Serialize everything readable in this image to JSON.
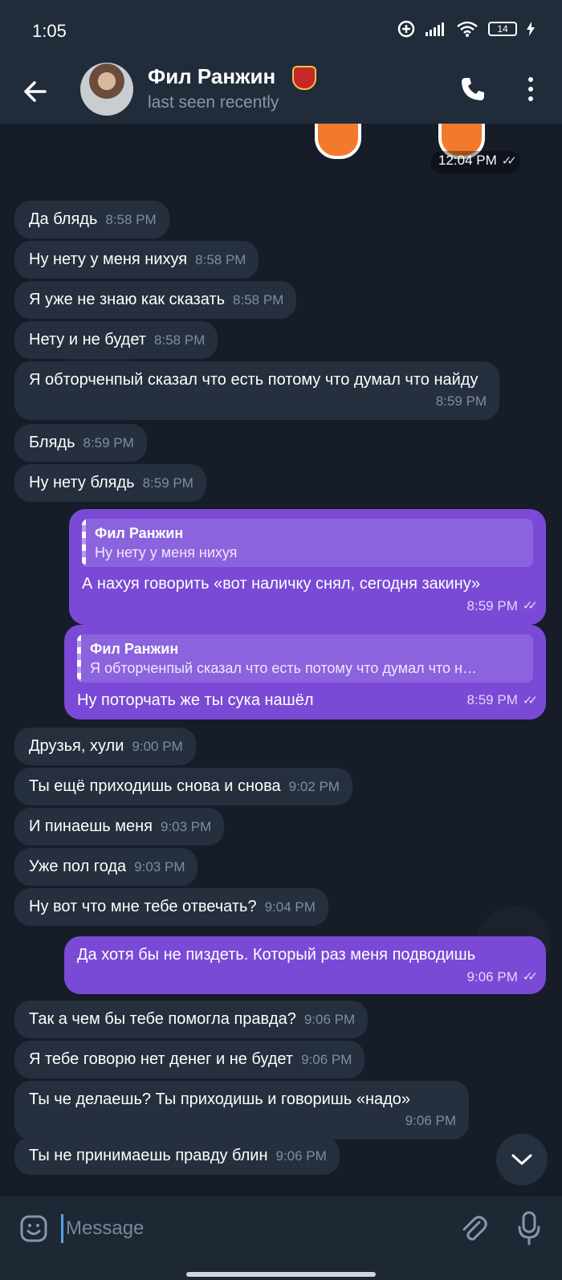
{
  "status": {
    "time": "1:05",
    "battery": "14"
  },
  "chat": {
    "name": "Фил Ранжин",
    "subtitle": "last seen recently"
  },
  "sticker_time": "12:04 PM",
  "messages": [
    {
      "text": "Да блядь",
      "time": "8:58 PM"
    },
    {
      "text": "Ну нету у меня нихуя",
      "time": "8:58 PM"
    },
    {
      "text": "Я уже не знаю как сказать",
      "time": "8:58 PM"
    },
    {
      "text": "Нету и не будет",
      "time": "8:58 PM"
    },
    {
      "text": "Я обторченпый сказал что есть потому что думал что найду",
      "time": "8:59 PM"
    },
    {
      "text": "Блядь",
      "time": "8:59 PM"
    },
    {
      "text": "Ну нету блядь",
      "time": "8:59 PM"
    },
    {
      "reply_name": "Фил Ранжин",
      "reply_text": "Ну нету у меня нихуя",
      "text": "А нахуя говорить «вот наличку снял, сегодня закину»",
      "time": "8:59 PM"
    },
    {
      "reply_name": "Фил Ранжин",
      "reply_text": "Я обторченпый сказал что есть потому что думал что н…",
      "text": "Ну поторчать же ты сука нашёл",
      "time": "8:59 PM"
    },
    {
      "text": "Друзья, хули",
      "time": "9:00 PM"
    },
    {
      "text": "Ты ещё приходишь снова и снова",
      "time": "9:02 PM"
    },
    {
      "text": "И пинаешь меня",
      "time": "9:03 PM"
    },
    {
      "text": "Уже пол года",
      "time": "9:03 PM"
    },
    {
      "text": "Ну вот что мне тебе отвечать?",
      "time": "9:04 PM"
    },
    {
      "text": "Да хотя бы не пиздеть. Который раз меня подводишь",
      "time": "9:06 PM"
    },
    {
      "text": "Так а чем бы тебе помогла правда?",
      "time": "9:06 PM"
    },
    {
      "text": "Я тебе говорю нет денег и не будет",
      "time": "9:06 PM"
    },
    {
      "text": "Ты че делаешь? Ты приходишь и говоришь «надо»",
      "time": "9:06 PM"
    },
    {
      "text": "Ты не принимаешь правду блин",
      "time": "9:06 PM"
    }
  ],
  "composer": {
    "placeholder": "Message"
  },
  "colors": {
    "outgoing": "#7a4ad6",
    "incoming": "#252f3d",
    "background": "#161d28"
  }
}
